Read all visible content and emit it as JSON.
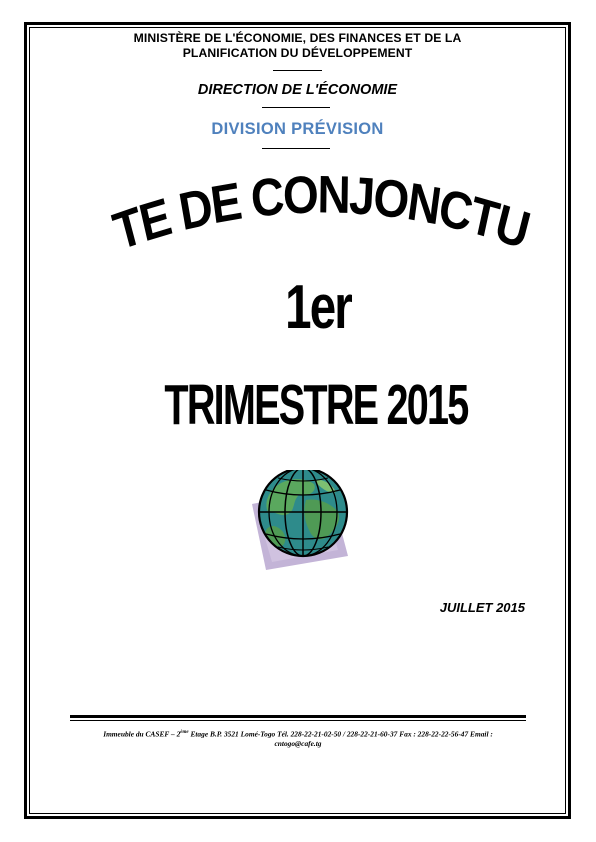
{
  "header": {
    "ministry_line1": "MINISTÈRE DE L'ÉCONOMIE, DES FINANCES ET DE LA",
    "ministry_line2": "PLANIFICATION DU DÉVELOPPEMENT",
    "direction": "DIRECTION DE L'ÉCONOMIE",
    "division": "DIVISION PRÉVISION"
  },
  "title": {
    "line1": "NOTE DE CONJONCTURE",
    "line2": "1er",
    "line3": "TRIMESTRE 2015"
  },
  "date": "JUILLET 2015",
  "footer": {
    "part1": "Immeuble du CASEF – 2",
    "superscript": "ème",
    "part2": " Etage B.P. 3521 Lomé-Togo Tél. 228-22-21-02-50 / 228-22-21-60-37  Fax : 228-22-22-56-47 Email :",
    "line2": "cntogo@cafe.tg"
  },
  "colors": {
    "division_blue": "#4f81bd",
    "globe_ocean": "#2e8b8b",
    "globe_land": "#4f9a55",
    "globe_shadow": "#b9a7d0"
  },
  "icons": [
    "globe-clipart-icon"
  ]
}
